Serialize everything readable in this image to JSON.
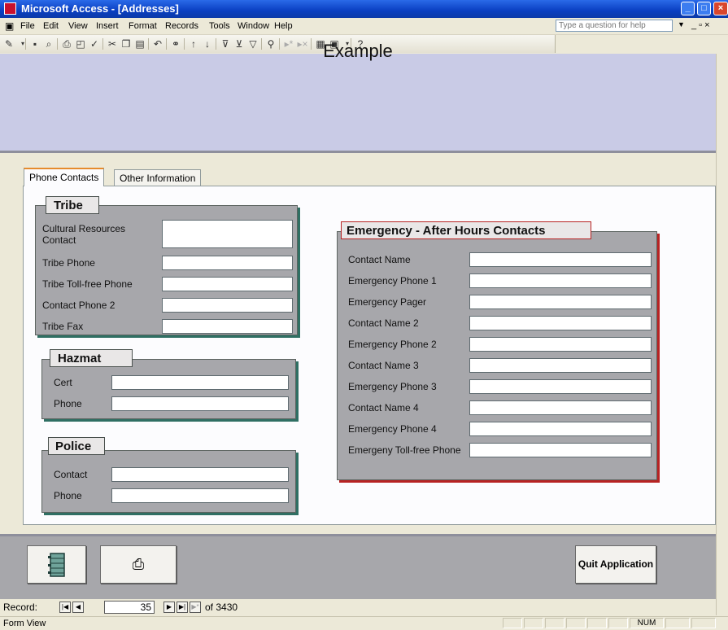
{
  "window": {
    "title": "Microsoft Access - [Addresses]"
  },
  "menu": {
    "items": [
      "File",
      "Edit",
      "View",
      "Insert",
      "Format",
      "Records",
      "Tools",
      "Window",
      "Help"
    ],
    "help_placeholder": "Type a question for help"
  },
  "toolbar": {
    "icons": [
      "design-view-icon",
      "save-icon",
      "search-icon",
      "print-icon",
      "print-preview-icon",
      "spelling-icon",
      "cut-icon",
      "copy-icon",
      "paste-icon",
      "undo-icon",
      "hyperlink-icon",
      "sort-ascending-icon",
      "sort-descending-icon",
      "filter-by-selection-icon",
      "filter-by-form-icon",
      "apply-filter-icon",
      "find-icon",
      "new-record-icon",
      "delete-record-icon",
      "database-window-icon",
      "new-object-icon",
      "help-icon"
    ]
  },
  "form": {
    "title": "Example",
    "tabs": [
      "Phone Contacts",
      "Other Information"
    ],
    "tribe": {
      "title": "Tribe",
      "fields": [
        "Cultural Resources Contact",
        "Tribe Phone",
        "Tribe Toll-free Phone",
        "Contact Phone 2",
        "Tribe Fax"
      ]
    },
    "hazmat": {
      "title": "Hazmat",
      "fields": [
        "Cert",
        "Phone"
      ]
    },
    "police": {
      "title": "Police",
      "fields": [
        "Contact",
        "Phone"
      ]
    },
    "emergency": {
      "title": "Emergency - After Hours Contacts",
      "fields": [
        "Contact Name",
        "Emergency Phone 1",
        "Emergency Pager",
        "Contact Name 2",
        "Emergency Phone 2",
        "Contact Name 3",
        "Emergency Phone 3",
        "Contact Name 4",
        "Emergency Phone 4",
        "Emergeny Toll-free Phone"
      ]
    },
    "footer": {
      "notebook_icon": "notebook-icon",
      "print_icon": "printer-icon",
      "quit_label": "Quit Application"
    }
  },
  "record_nav": {
    "label": "Record:",
    "current": "35",
    "of_text": "of 3430"
  },
  "status": {
    "mode": "Form View",
    "num": "NUM"
  }
}
